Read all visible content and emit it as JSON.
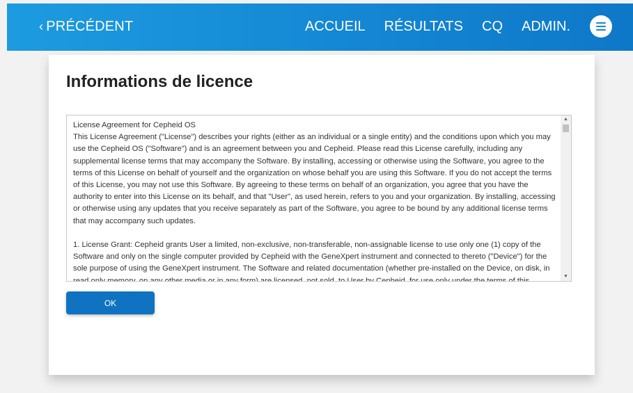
{
  "navbar": {
    "back_chevron": "‹",
    "back_label": "PRÉCÉDENT",
    "links": [
      "ACCUEIL",
      "RÉSULTATS",
      "CQ",
      "ADMIN."
    ],
    "menu_icon": "hamburger-icon",
    "gradient_start": "#1d9be0",
    "gradient_end": "#0e78c8"
  },
  "page": {
    "title": "Informations de licence"
  },
  "license": {
    "heading": "License Agreement for Cepheid OS",
    "paragraph1": "This License Agreement (\"License\") describes your rights (either as an individual or a single entity) and the conditions upon which you may use the Cepheid OS (\"Software\") and is an agreement between you and Cepheid.  Please read this License carefully, including any supplemental license terms that may accompany the Software. By installing, accessing or otherwise using the Software, you agree to the terms of this License on behalf of yourself and the organization on whose behalf you are using this Software. If you do not accept the terms of this License, you may not use this Software. By agreeing to these terms on behalf of an organization, you agree that you have the authority to enter into this License on its behalf, and that \"User\", as used herein, refers to you and your organization.  By installing, accessing or otherwise using any updates that you receive separately as part of the Software, you agree to be bound by any additional license terms that may accompany such updates.",
    "paragraph2": "1.    License Grant: Cepheid grants User a limited, non-exclusive, non-transferable, non-assignable license to use only one (1) copy of the Software and only on the single computer provided by Cepheid with the GeneXpert instrument and connected to thereto (\"Device\") for the sole purpose of using the GeneXpert instrument. The Software and related documentation (whether pre-installed on the Device, on disk, in read only memory, on any other media or in any form) are licensed, not sold, to User by Cepheid, for use only under the terms of this"
  },
  "actions": {
    "ok_label": "OK",
    "ok_color": "#0f73c2"
  }
}
